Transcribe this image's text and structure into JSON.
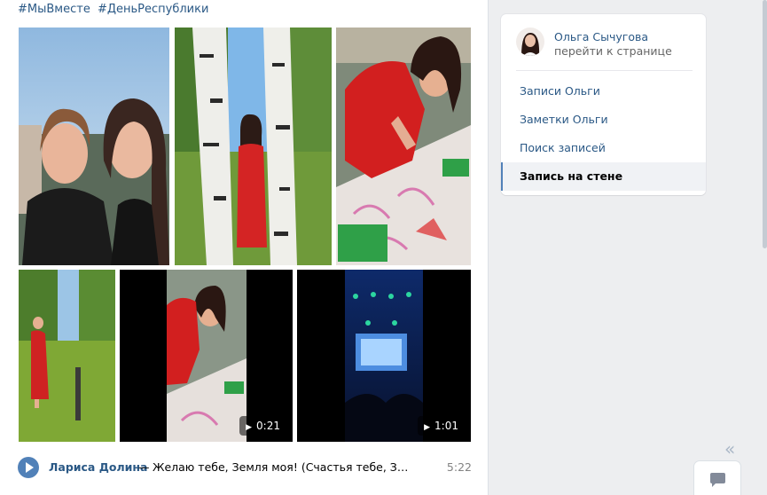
{
  "post": {
    "hashtags": [
      "#МыВместе",
      "#ДеньРеспублики"
    ],
    "media": [
      {
        "name": "photo-selfie",
        "kind": "photo"
      },
      {
        "name": "photo-birch-trees",
        "kind": "photo"
      },
      {
        "name": "photo-drawing-table",
        "kind": "photo"
      },
      {
        "name": "photo-park",
        "kind": "photo"
      },
      {
        "name": "video-drawing",
        "kind": "video",
        "duration": "0:21"
      },
      {
        "name": "video-concert",
        "kind": "video",
        "duration": "1:01"
      }
    ],
    "audio": {
      "artist": "Лариса Долина",
      "separator": "—",
      "title": "Желаю тебе, Земля моя! (Счастья тебе, Земля моя!)",
      "duration": "5:22"
    }
  },
  "menu": {
    "user_name": "Ольга Сычугова",
    "user_link": "перейти к странице",
    "items": [
      "Записи Ольги",
      "Заметки Ольги",
      "Поиск записей",
      "Запись на стене"
    ],
    "selected_item": "Запись на стене"
  },
  "icons": {
    "collapse": "double-chevron-left-icon",
    "chat": "chat-bubble-icon",
    "play": "play-icon"
  },
  "colors": {
    "link": "#2a5885",
    "accent": "#5181b8",
    "page_bg": "#edeef0"
  }
}
